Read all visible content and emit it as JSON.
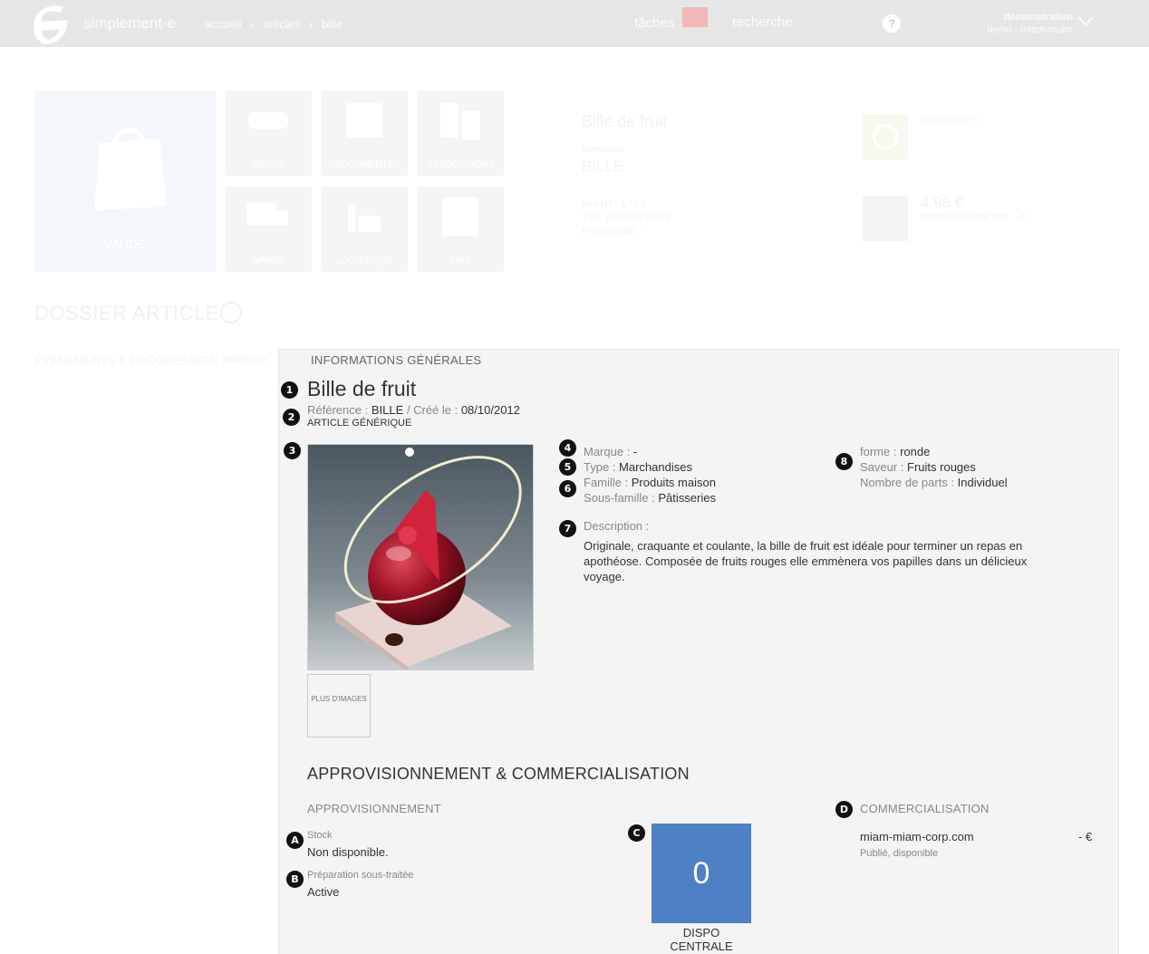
{
  "topbar": {
    "brand": "simplement-e",
    "breadcrumb": [
      "accueil",
      "›",
      "articles",
      "›",
      "bille"
    ],
    "tasks_label": "tâches",
    "search_placeholder": "recherche",
    "help_label": "?",
    "user_name": "demonstration",
    "user_company": "demo - miam-miam"
  },
  "header": {
    "status_label": "VALIDÉ",
    "tiles": [
      "VENTE",
      "DOCUMENTS",
      "ASSOCIATIONS",
      "APPRO",
      "LOGISTIQUE",
      "PRIX"
    ],
    "ghost_title": "Bille de fruit",
    "ghost_ref_label": "Référence",
    "ghost_ref": "BILLE",
    "ghost_lines": [
      "Sort HT : 4,72 €",
      "TVA : (10,00%) 0,26 €",
      "Prix conseillé : -"
    ],
    "ghost_dispo": "Disposition : 0",
    "ghost_price": "4,98 €",
    "ghost_price_sub": "miam-miam-corp.com : - €"
  },
  "dossier": {
    "title": "DOSSIER ARTICLE",
    "events": "ÉVÉNEMENTS & PROGRESSION",
    "notif": "Notif/Fiche"
  },
  "info": {
    "section_title": "INFORMATIONS GÉNÉRALES",
    "product_title": "Bille de fruit",
    "ref_label": "Référence : ",
    "ref_value": "BILLE",
    "created_label": " / Créé le : ",
    "created_value": "08/10/2012",
    "generic": "ARTICLE GÉNÉRIQUE",
    "more_images": "PLUS D'IMAGES",
    "attributes": {
      "marque_k": "Marque : ",
      "marque_v": "-",
      "type_k": "Type : ",
      "type_v": "Marchandises",
      "famille_k": "Famille : ",
      "famille_v": "Produits maison",
      "sousfamille_k": "Sous-famille : ",
      "sousfamille_v": "Pâtisseries",
      "forme_k": "forme : ",
      "forme_v": "ronde",
      "saveur_k": "Saveur : ",
      "saveur_v": "Fruits rouges",
      "parts_k": "Nombre de parts : ",
      "parts_v": "Individuel"
    },
    "description_label": "Description :",
    "description": "Originale, craquante et coulante, la bille de fruit est idéale pour terminer un repas en apothéose. Composée de fruits rouges elle emmènera vos papilles dans un délicieux voyage."
  },
  "appro": {
    "section_title": "APPROVISIONNEMENT & COMMERCIALISATION",
    "appro_title": "APPROVISIONNEMENT",
    "stock_label": "Stock",
    "stock_value": "Non disponible.",
    "prep_label": "Préparation sous-traitée",
    "prep_value": "Active",
    "dispo_value": "0",
    "dispo_label": "DISPO CENTRALE",
    "commerc_title": "COMMERCIALISATION",
    "site": "miam-miam-corp.com",
    "site_price": "- €",
    "site_status": "Publié, disponible"
  },
  "markers": [
    "1",
    "2",
    "3",
    "4",
    "5",
    "6",
    "7",
    "8",
    "A",
    "B",
    "C",
    "D"
  ],
  "colors": {
    "accent_blue": "#4d80c5",
    "panel_bg": "#f4f4f4",
    "marker_bg": "#111111"
  }
}
